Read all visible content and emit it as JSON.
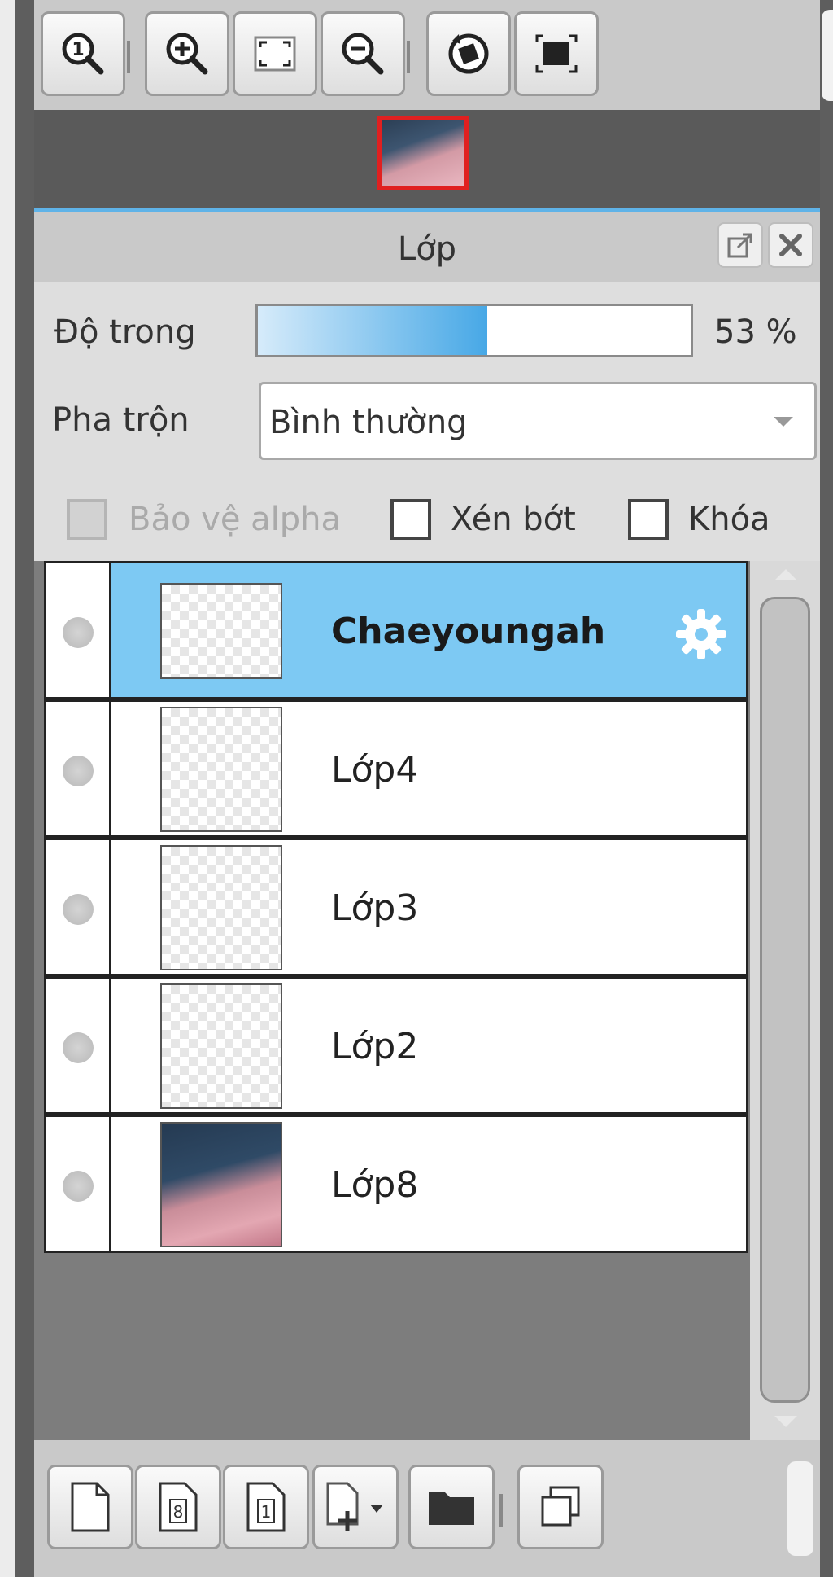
{
  "toolbar": {
    "buttons": [
      {
        "icon": "zoom-actual-size-icon"
      },
      {
        "icon": "zoom-in-icon"
      },
      {
        "icon": "fit-to-window-icon"
      },
      {
        "icon": "zoom-out-icon"
      },
      {
        "icon": "rotate-icon"
      },
      {
        "icon": "fit-canvas-icon"
      }
    ]
  },
  "panel": {
    "title": "Lớp",
    "opacity_label": "Độ trong",
    "opacity_value": "53 %",
    "opacity_fraction": 0.53,
    "blend_label": "Pha trộn",
    "blend_mode": "Bình thường",
    "protect_alpha_label": "Bảo vệ alpha",
    "clipping_label": "Xén bớt",
    "lock_label": "Khóa"
  },
  "layers": [
    {
      "name": "Chaeyoungah",
      "selected": true
    },
    {
      "name": "Lớp4",
      "selected": false
    },
    {
      "name": "Lớp3",
      "selected": false
    },
    {
      "name": "Lớp2",
      "selected": false
    },
    {
      "name": "Lớp8",
      "selected": false
    }
  ],
  "bottom_toolbar": {
    "buttons": [
      {
        "icon": "new-layer-icon"
      },
      {
        "icon": "new-8bit-layer-icon"
      },
      {
        "icon": "new-1bit-layer-icon"
      },
      {
        "icon": "add-layer-dropdown-icon"
      },
      {
        "icon": "new-folder-icon"
      },
      {
        "icon": "duplicate-layer-icon"
      }
    ]
  },
  "colors": {
    "selection": "#7dc9f3",
    "accent_line": "#5fb3e8",
    "opacity_fill": "#47a8e6",
    "navigator_border": "#e02020"
  }
}
